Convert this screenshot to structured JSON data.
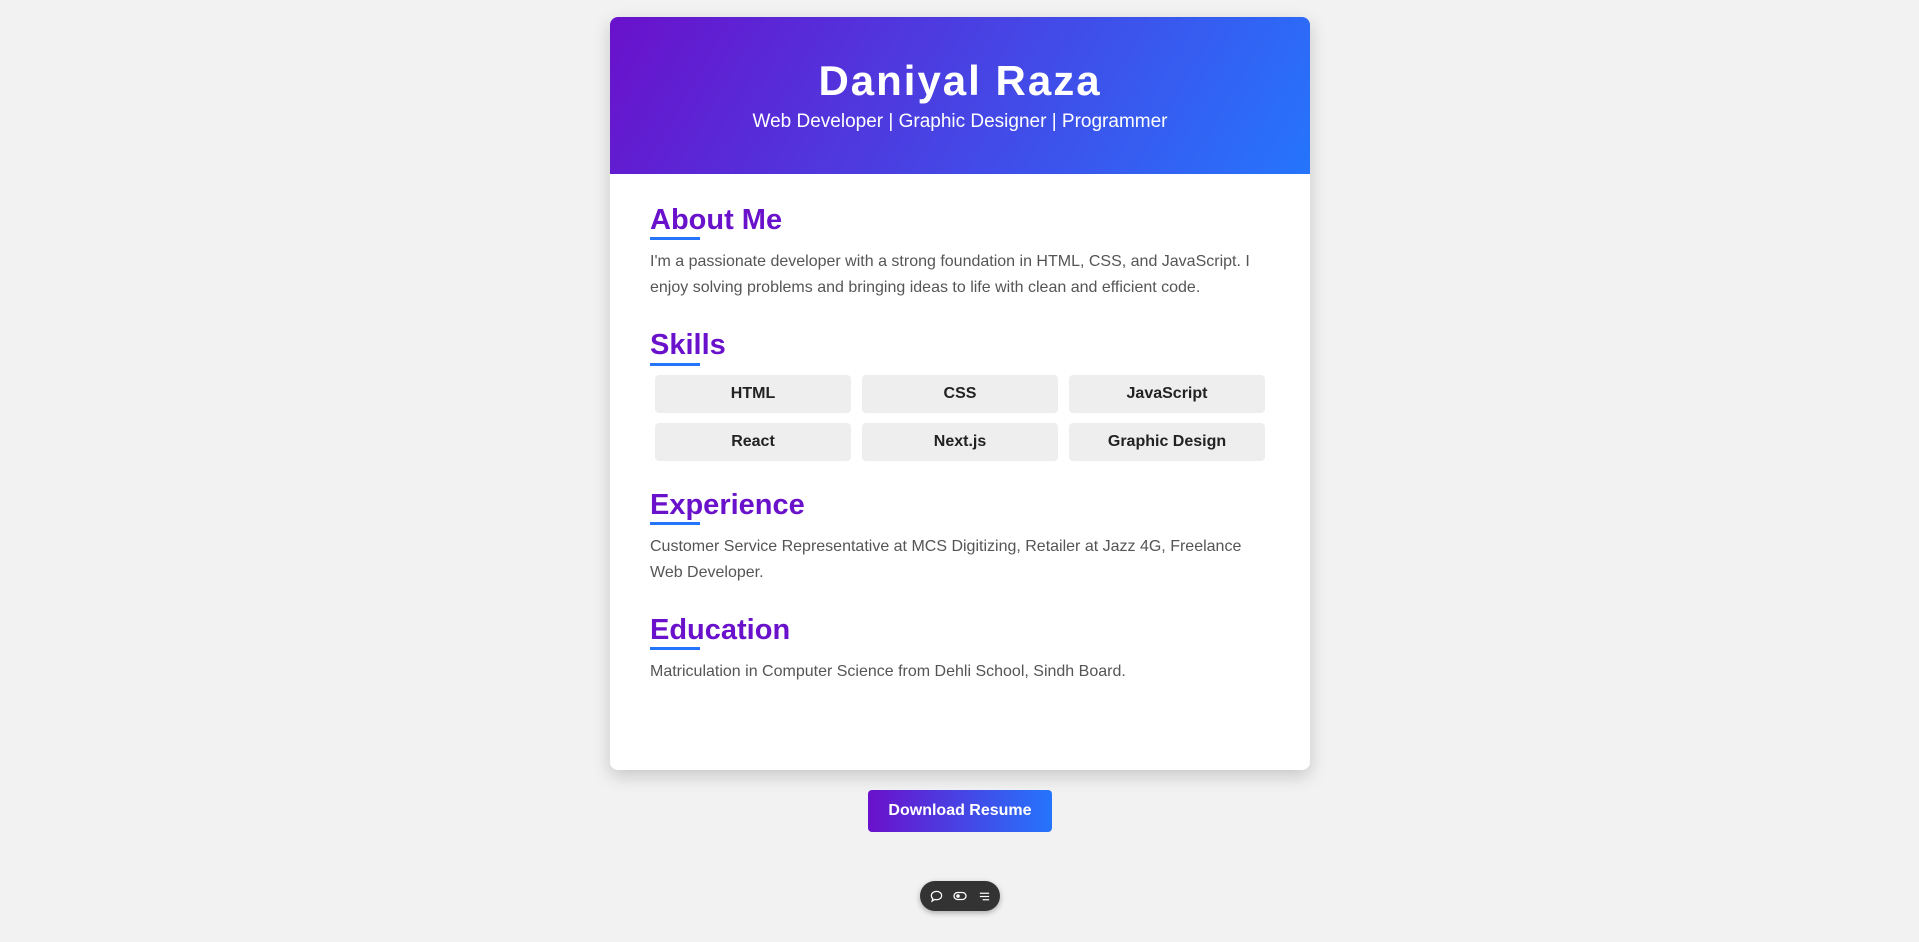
{
  "header": {
    "name": "Daniyal Raza",
    "tagline": "Web Developer | Graphic Designer | Programmer"
  },
  "about": {
    "title": "About Me",
    "text": "I'm a passionate developer with a strong foundation in HTML, CSS, and JavaScript. I enjoy solving problems and bringing ideas to life with clean and efficient code."
  },
  "skills": {
    "title": "Skills",
    "items": [
      "HTML",
      "CSS",
      "JavaScript",
      "React",
      "Next.js",
      "Graphic Design"
    ]
  },
  "experience": {
    "title": "Experience",
    "text": "Customer Service Representative at MCS Digitizing, Retailer at Jazz 4G, Freelance Web Developer."
  },
  "education": {
    "title": "Education",
    "text": "Matriculation in Computer Science from Dehli School, Sindh Board."
  },
  "download_button": {
    "label": "Download Resume"
  },
  "toolbar": {
    "icons": [
      "comment-icon",
      "toggle-icon",
      "menu-icon"
    ]
  },
  "colors": {
    "accent_purple": "#6a11cb",
    "accent_blue": "#2575fc",
    "background": "#f2f2f2",
    "skill_bg": "#eeeeee"
  }
}
